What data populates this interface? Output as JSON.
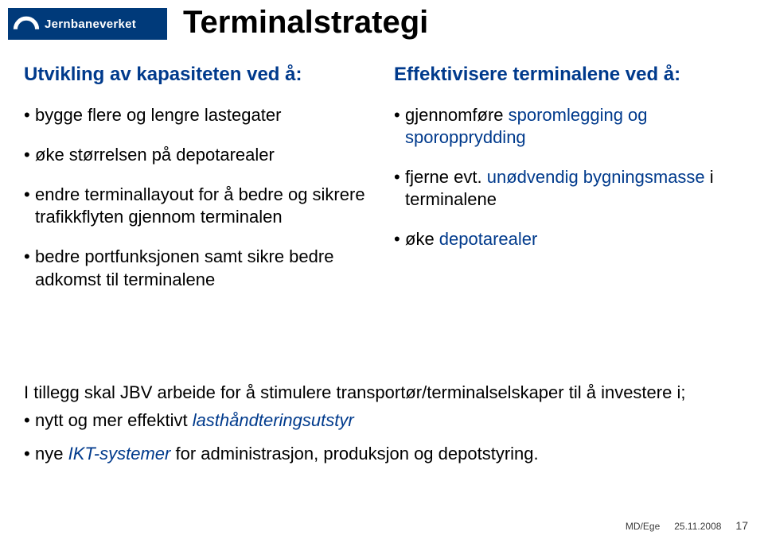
{
  "brand": {
    "name": "Jernbaneverket",
    "icon": "arc-logo"
  },
  "title": "Terminalstrategi",
  "left": {
    "heading": "Utvikling av kapasiteten ved å:",
    "items": [
      "bygge flere og lengre lastegater",
      "øke størrelsen på depotarealer",
      "endre terminallayout for å bedre og sikrere trafikkflyten gjennom terminalen",
      "bedre portfunksjonen samt sikre bedre adkomst til terminalene"
    ]
  },
  "right": {
    "heading": "Effektivisere terminalene ved å:",
    "items": [
      {
        "prefix": "gjennomføre ",
        "accent": "sporomlegging og sporopprydding",
        "suffix": ""
      },
      {
        "prefix": "fjerne evt. ",
        "accent": "unødvendig bygningsmasse",
        "suffix": " i terminalene"
      },
      {
        "prefix": "øke ",
        "accent": "depotarealer",
        "suffix": ""
      }
    ]
  },
  "bottom": {
    "lead": "I tillegg skal JBV arbeide for å stimulere transportør/terminalselskaper til å investere i;",
    "items": [
      {
        "prefix": "nytt og mer effektivt ",
        "accent": "lasthåndteringsutstyr",
        "suffix": ""
      },
      {
        "prefix": "nye ",
        "accent": "IKT-systemer",
        "suffix": " for administrasjon, produksjon og depotstyring."
      }
    ]
  },
  "footer": {
    "author": "MD/Ege",
    "date": "25.11.2008",
    "page": "17"
  }
}
